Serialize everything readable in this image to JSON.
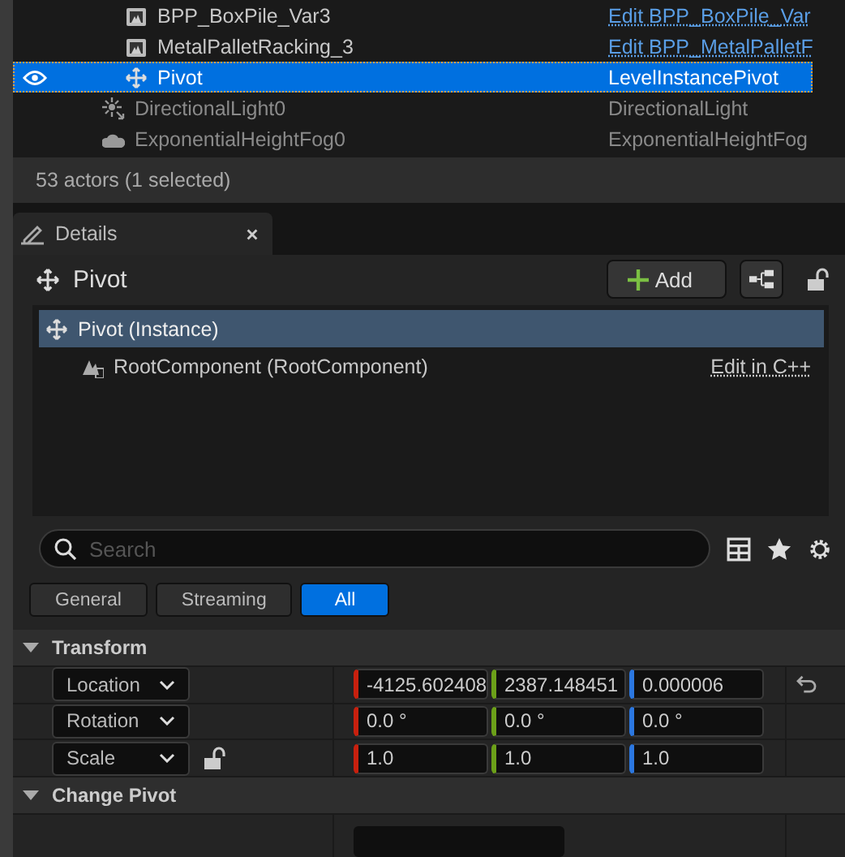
{
  "outliner": {
    "rows": [
      {
        "children": [
          {
            "label": "BPP_BoxPile_Var3",
            "kind": "mesh",
            "type": "Edit BPP_BoxPile_Var",
            "type_is_link": true,
            "selected": false
          },
          {
            "label": "MetalPalletRacking_3",
            "kind": "mesh",
            "type": "Edit BPP_MetalPalletF",
            "type_is_link": true,
            "selected": false
          },
          {
            "label": "Pivot",
            "kind": "move",
            "type": "LevelInstancePivot",
            "type_is_link": false,
            "selected": true
          }
        ]
      },
      {
        "label": "DirectionalLight0",
        "kind": "light",
        "type": "DirectionalLight",
        "type_is_link": false,
        "selected": false
      },
      {
        "label": "ExponentialHeightFog0",
        "kind": "fog",
        "type": "ExponentialHeightFog",
        "type_is_link": false,
        "selected": false
      }
    ],
    "status": "53 actors (1 selected)"
  },
  "details": {
    "tab": "Details",
    "actor": "Pivot",
    "add_button": "Add",
    "header_locked": false,
    "components": [
      {
        "label": "Pivot (Instance)",
        "kind": "move",
        "selected": true,
        "children": [
          {
            "label": "RootComponent (RootComponent)",
            "kind": "root",
            "selected": false,
            "action": "Edit in C++"
          }
        ]
      }
    ],
    "search": {
      "placeholder": "Search"
    },
    "filters": [
      {
        "label": "General",
        "selected": false
      },
      {
        "label": "Streaming",
        "selected": false
      },
      {
        "label": "All",
        "selected": true
      }
    ],
    "sections": [
      {
        "title": "Transform",
        "expanded": true,
        "rows": [
          {
            "kind": "vector",
            "label": "Location",
            "values": [
              "-4125.602408",
              "2387.148451",
              "0.000006"
            ],
            "reset": true,
            "locked": null
          },
          {
            "kind": "vector",
            "label": "Rotation",
            "values": [
              "0.0 °",
              "0.0 °",
              "0.0 °"
            ],
            "reset": false,
            "locked": null
          },
          {
            "kind": "vector",
            "label": "Scale",
            "values": [
              "1.0",
              "1.0",
              "1.0"
            ],
            "reset": false,
            "locked": false
          }
        ]
      },
      {
        "title": "Change Pivot",
        "expanded": true,
        "rows": [
          {
            "kind": "blank_field"
          }
        ]
      }
    ]
  }
}
